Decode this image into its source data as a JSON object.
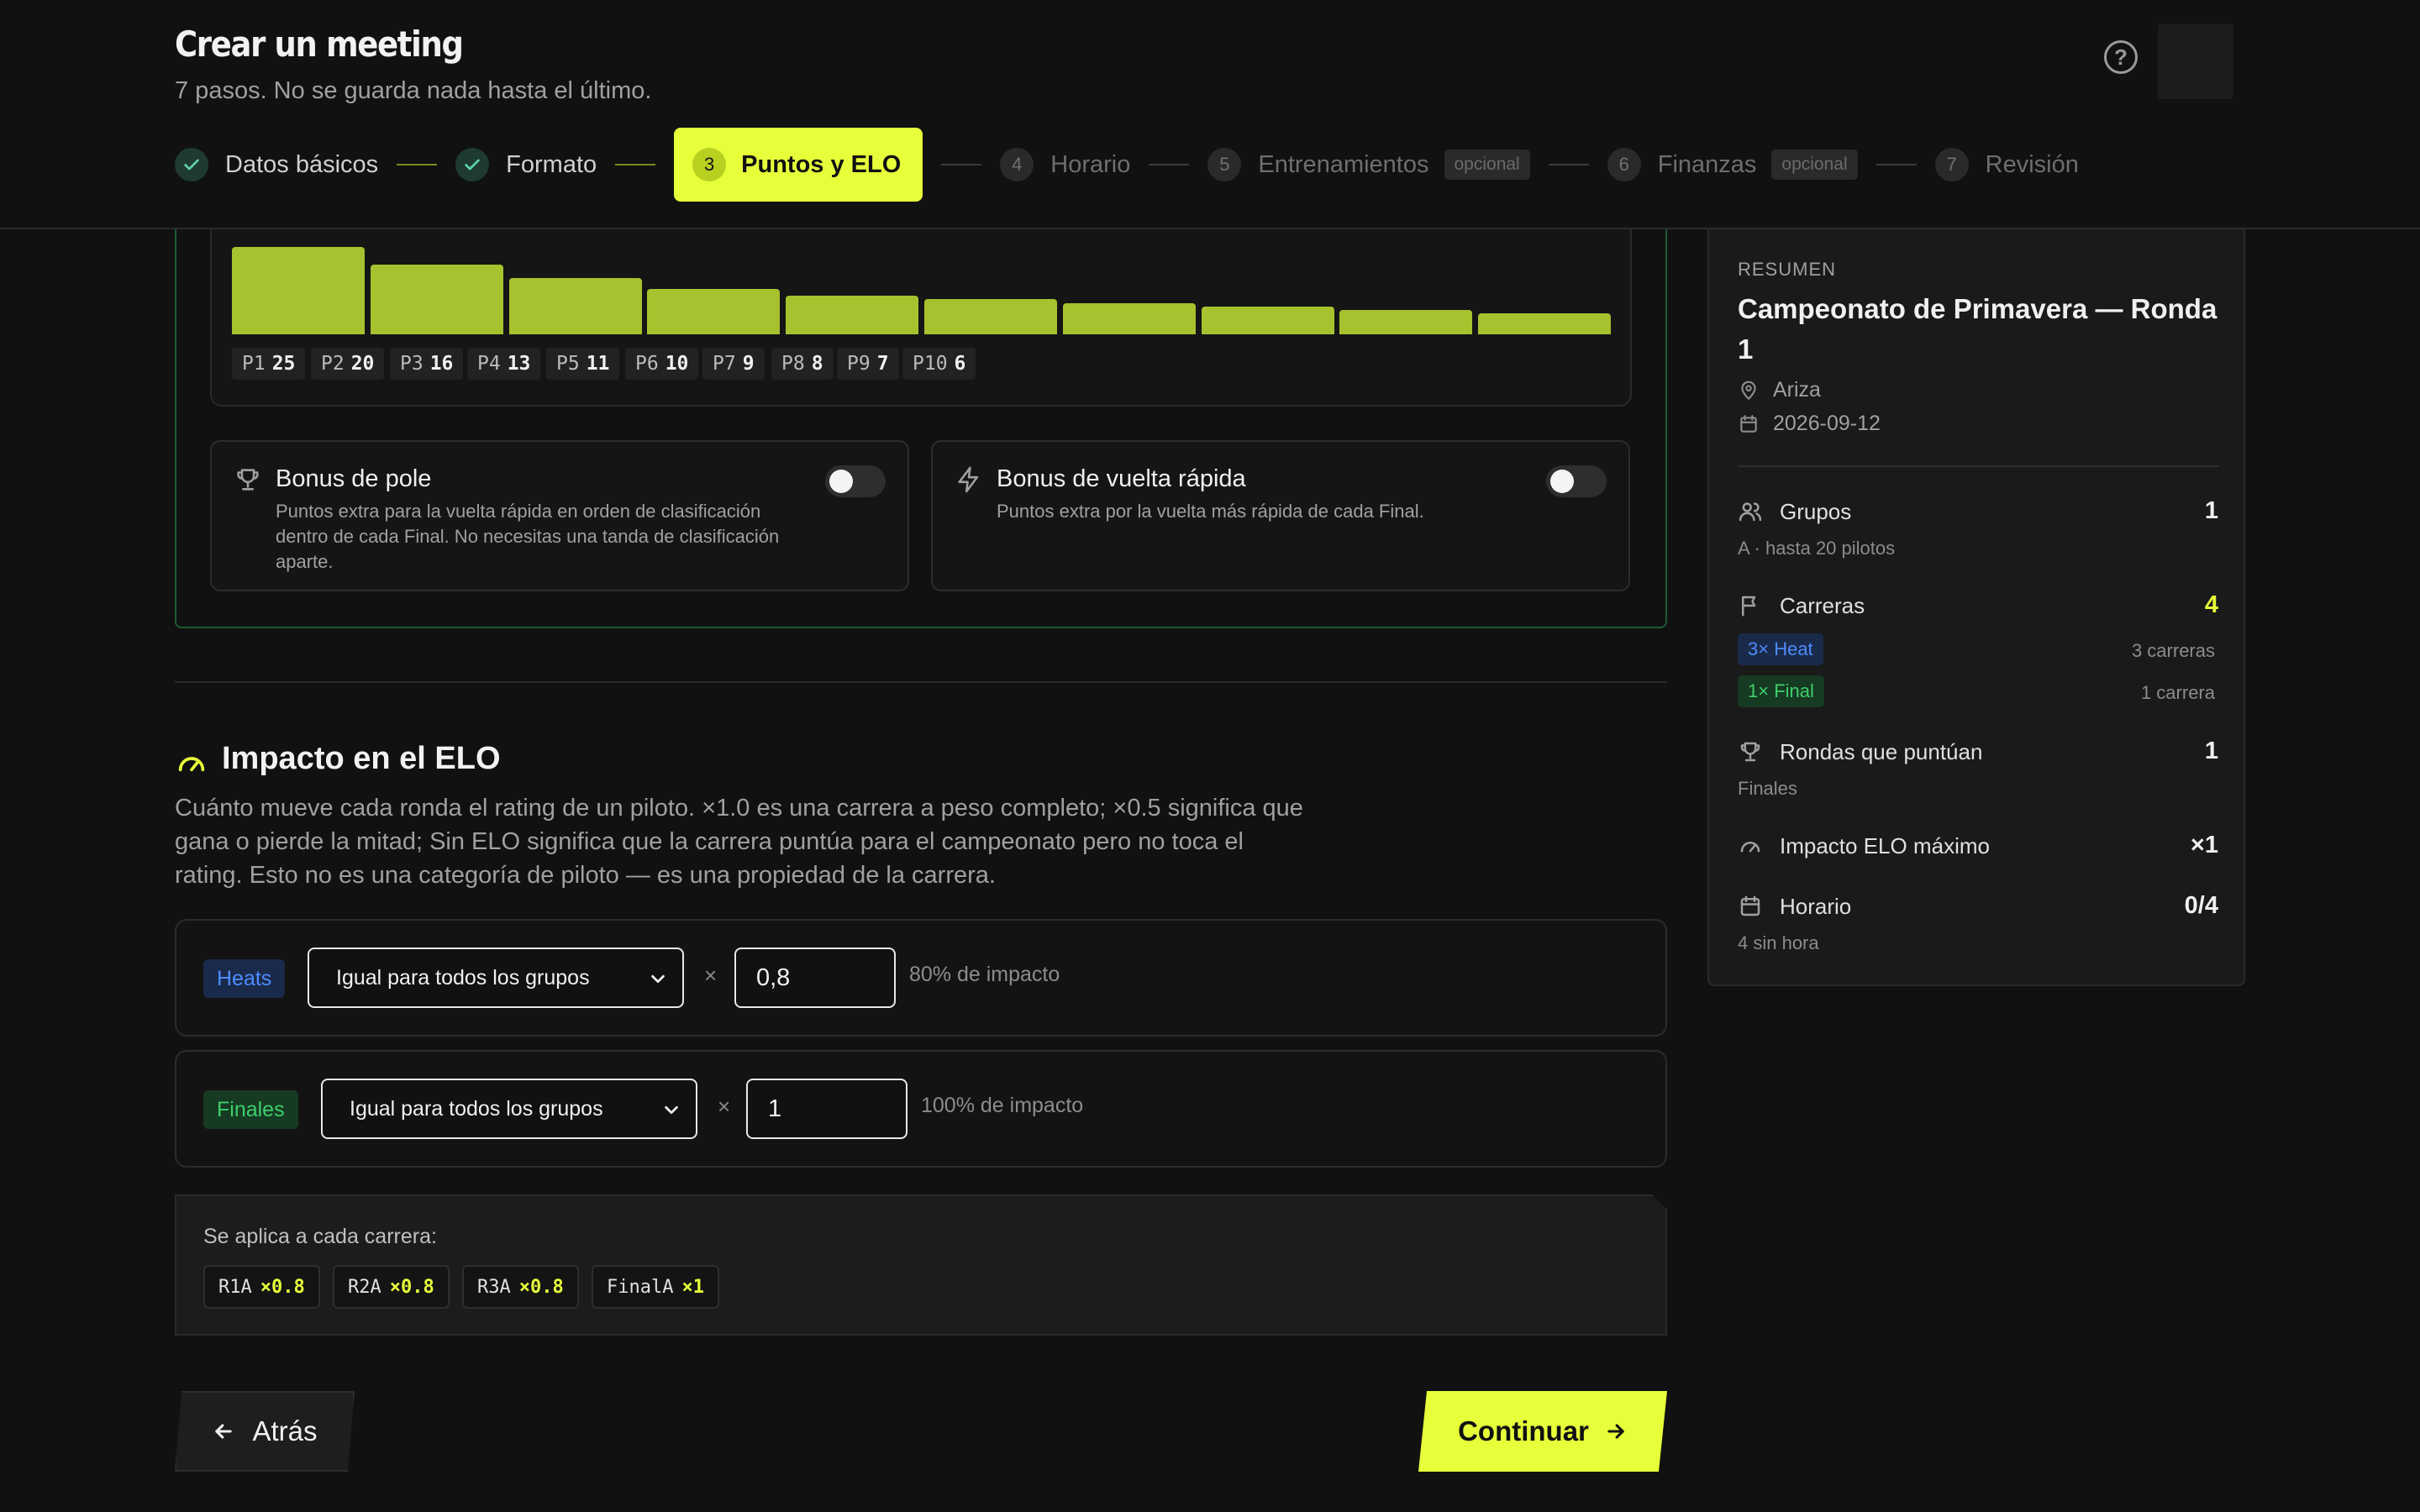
{
  "header": {
    "title": "Crear un meeting",
    "subtitle": "7 pasos. No se guarda nada hasta el último.",
    "help_icon": "question-circle-icon"
  },
  "steps": [
    {
      "num": "1",
      "label": "Datos básicos",
      "state": "done"
    },
    {
      "num": "2",
      "label": "Formato",
      "state": "done"
    },
    {
      "num": "3",
      "label": "Puntos y ELO",
      "state": "active"
    },
    {
      "num": "4",
      "label": "Horario",
      "state": "future"
    },
    {
      "num": "5",
      "label": "Entrenamientos",
      "state": "future",
      "badge": "opcional"
    },
    {
      "num": "6",
      "label": "Finanzas",
      "state": "future",
      "badge": "opcional"
    },
    {
      "num": "7",
      "label": "Revisión",
      "state": "future"
    }
  ],
  "points": {
    "positions": [
      {
        "label": "P1",
        "points": 25
      },
      {
        "label": "P2",
        "points": 20
      },
      {
        "label": "P3",
        "points": 16
      },
      {
        "label": "P4",
        "points": 13
      },
      {
        "label": "P5",
        "points": 11
      },
      {
        "label": "P6",
        "points": 10
      },
      {
        "label": "P7",
        "points": 9
      },
      {
        "label": "P8",
        "points": 8
      },
      {
        "label": "P9",
        "points": 7
      },
      {
        "label": "P10",
        "points": 6
      }
    ]
  },
  "bonus": {
    "pole": {
      "title": "Bonus de pole",
      "desc": "Puntos extra para la vuelta rápida en orden de clasificación dentro de cada Final. No necesitas una tanda de clasificación aparte.",
      "enabled": false
    },
    "fastest_lap": {
      "title": "Bonus de vuelta rápida",
      "desc": "Puntos extra por la vuelta más rápida de cada Final.",
      "enabled": false
    }
  },
  "elo": {
    "title": "Impacto en el ELO",
    "desc": "Cuánto mueve cada ronda el rating de un piloto. ×1.0 es una carrera a peso completo; ×0.5 significa que gana o pierde la mitad; Sin ELO significa que la carrera puntúa para el campeonato pero no toca el rating. Esto no es una categoría de piloto — es una propiedad de la carrera.",
    "times": "×",
    "rows": [
      {
        "tag": "Heats",
        "select": "Igual para todos los grupos",
        "value": "0,8",
        "impact": "80% de impacto"
      },
      {
        "tag": "Finales",
        "select": "Igual para todos los grupos",
        "value": "1",
        "impact": "100% de impacto"
      }
    ],
    "apply_label": "Se aplica a cada carrera:",
    "races": [
      {
        "name": "R1A",
        "mult": "×0.8"
      },
      {
        "name": "R2A",
        "mult": "×0.8"
      },
      {
        "name": "R3A",
        "mult": "×0.8"
      },
      {
        "name": "FinalA",
        "mult": "×1"
      }
    ]
  },
  "nav": {
    "back": "Atrás",
    "continue": "Continuar"
  },
  "summary": {
    "kicker": "RESUMEN",
    "title": "Campeonato de Primavera — Ronda 1",
    "location": "Ariza",
    "date": "2026-09-12",
    "groups_label": "Grupos",
    "groups_value": "1",
    "groups_sub": "A · hasta 20 pilotos",
    "races_label": "Carreras",
    "races_value": "4",
    "heat_pill": "3× Heat",
    "heat_count": "3 carreras",
    "final_pill": "1× Final",
    "final_count": "1 carrera",
    "scoring_label": "Rondas que puntúan",
    "scoring_value": "1",
    "scoring_sub": "Finales",
    "elo_label": "Impacto ELO máximo",
    "elo_value": "×1",
    "schedule_label": "Horario",
    "schedule_value": "0/4",
    "schedule_sub": "4 sin hora"
  },
  "colors": {
    "accent": "#e6ff3a",
    "bar": "#a6c22e",
    "heat": "#4d8cff",
    "final": "#3ecf6b"
  }
}
